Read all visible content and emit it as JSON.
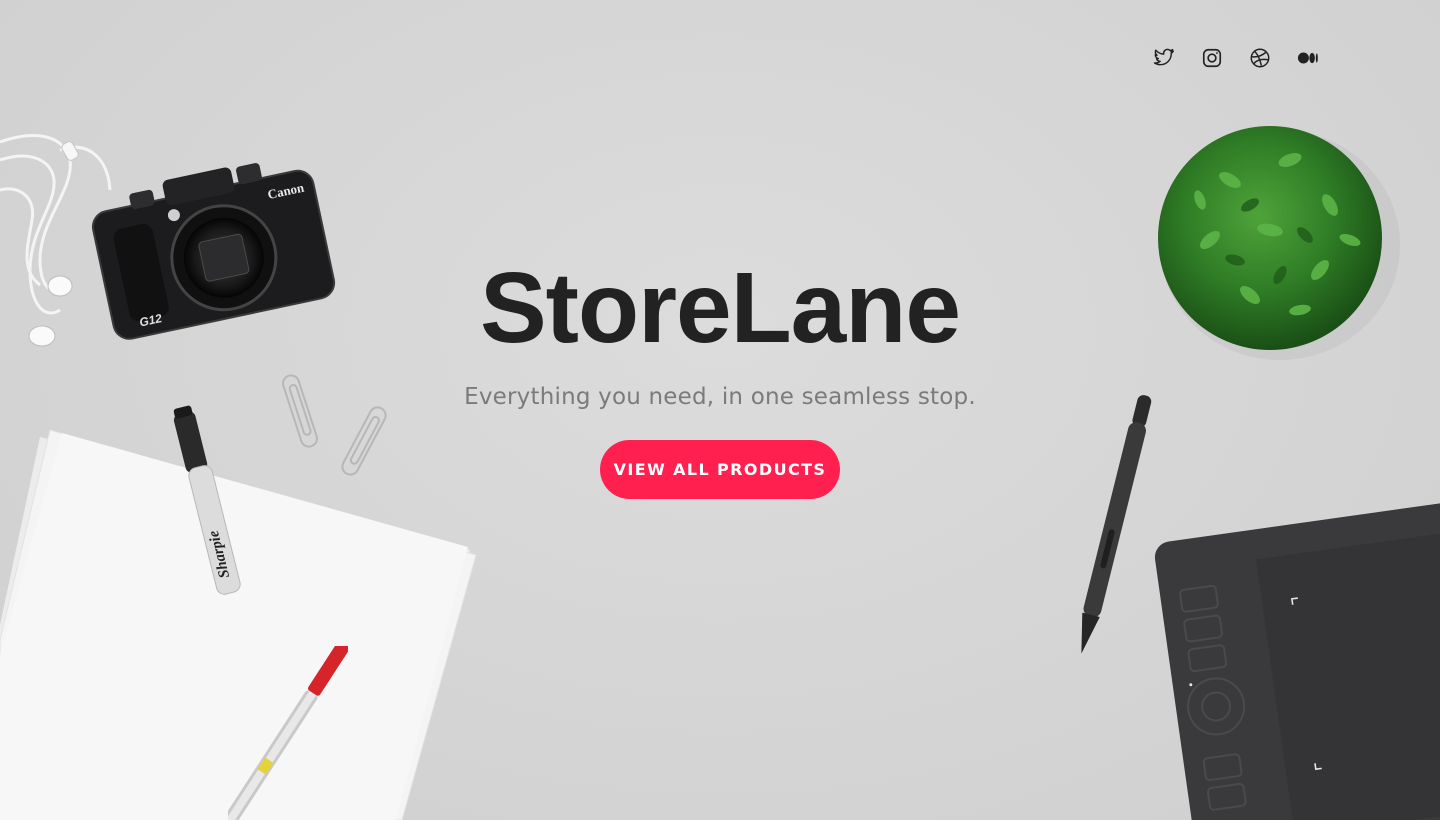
{
  "brand": {
    "title": "StoreLane",
    "tagline": "Everything you need, in one seamless stop."
  },
  "cta": {
    "label": "VIEW ALL PRODUCTS",
    "color": "#ff2050"
  },
  "social": [
    {
      "icon": "twitter-icon"
    },
    {
      "icon": "instagram-icon"
    },
    {
      "icon": "dribbble-icon"
    },
    {
      "icon": "medium-icon"
    }
  ],
  "camera": {
    "brand": "Canon",
    "model": "G12"
  },
  "marker": {
    "brand": "Sharpie"
  },
  "colors": {
    "background": "#d6d6d6",
    "title": "#222222",
    "tagline": "#7b7b7b",
    "accent": "#ff2050"
  }
}
